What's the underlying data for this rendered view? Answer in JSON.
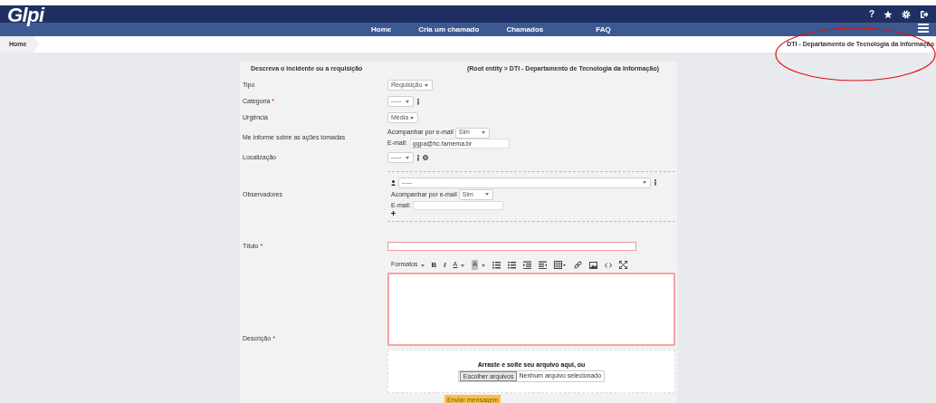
{
  "header": {
    "logo": "Glpi",
    "help": "?",
    "nav": [
      {
        "label": "Home"
      },
      {
        "label": "Cria um chamado"
      },
      {
        "label": "Chamados"
      },
      {
        "label": "FAQ"
      }
    ]
  },
  "breadcrumb": "Home",
  "entity": "DTI - Departamento de Tecnologia da Informação",
  "annotation": {
    "kind": "ellipse"
  },
  "form": {
    "title": "Descreva o incidente ou a requisição",
    "entity_path": "(Root entity > DTI - Departamento de Tecnologia da Informação)",
    "fields": [
      {
        "kind": "select",
        "label": "Tipo",
        "value": "Requisição",
        "info": false,
        "globe": false
      },
      {
        "kind": "select",
        "label": "Categoria",
        "required_mark": "*",
        "value": "-----",
        "info": true,
        "globe": false
      },
      {
        "kind": "select",
        "label": "Urgência",
        "value": "Média",
        "info": false,
        "globe": false
      },
      {
        "kind": "notify",
        "label": "Me informe sobre as ações tomadas",
        "follow_label": "Acompanhar por e-mail",
        "follow_value": "Sim",
        "email_label": "E-mail:",
        "email_value": "ggpa@hc.famema.br"
      },
      {
        "kind": "select",
        "label": "Localização",
        "value": "-----",
        "info": true,
        "globe": true
      },
      {
        "kind": "observers",
        "label": "Observadores",
        "value": "-----",
        "info": true,
        "follow_label": "Acompanhar por e-mail",
        "follow_value": "Sim",
        "email_label": "E-mail:"
      },
      {
        "kind": "text",
        "label": "Título",
        "required_mark": "*",
        "invalid": true
      },
      {
        "kind": "editor",
        "label": "Descrição",
        "required_mark": "*",
        "invalid": true,
        "toolbar": {
          "formats": "Formatos",
          "bold": "B",
          "italic": "I",
          "font_color": "A",
          "bg_color": "A"
        },
        "drop_text": "Arraste e solte seu arquivo aqui, ou",
        "file_button": "Escolher arquivos",
        "file_status": "Nenhum arquivo selecionado"
      }
    ],
    "submit": "Enviar mensagem"
  }
}
